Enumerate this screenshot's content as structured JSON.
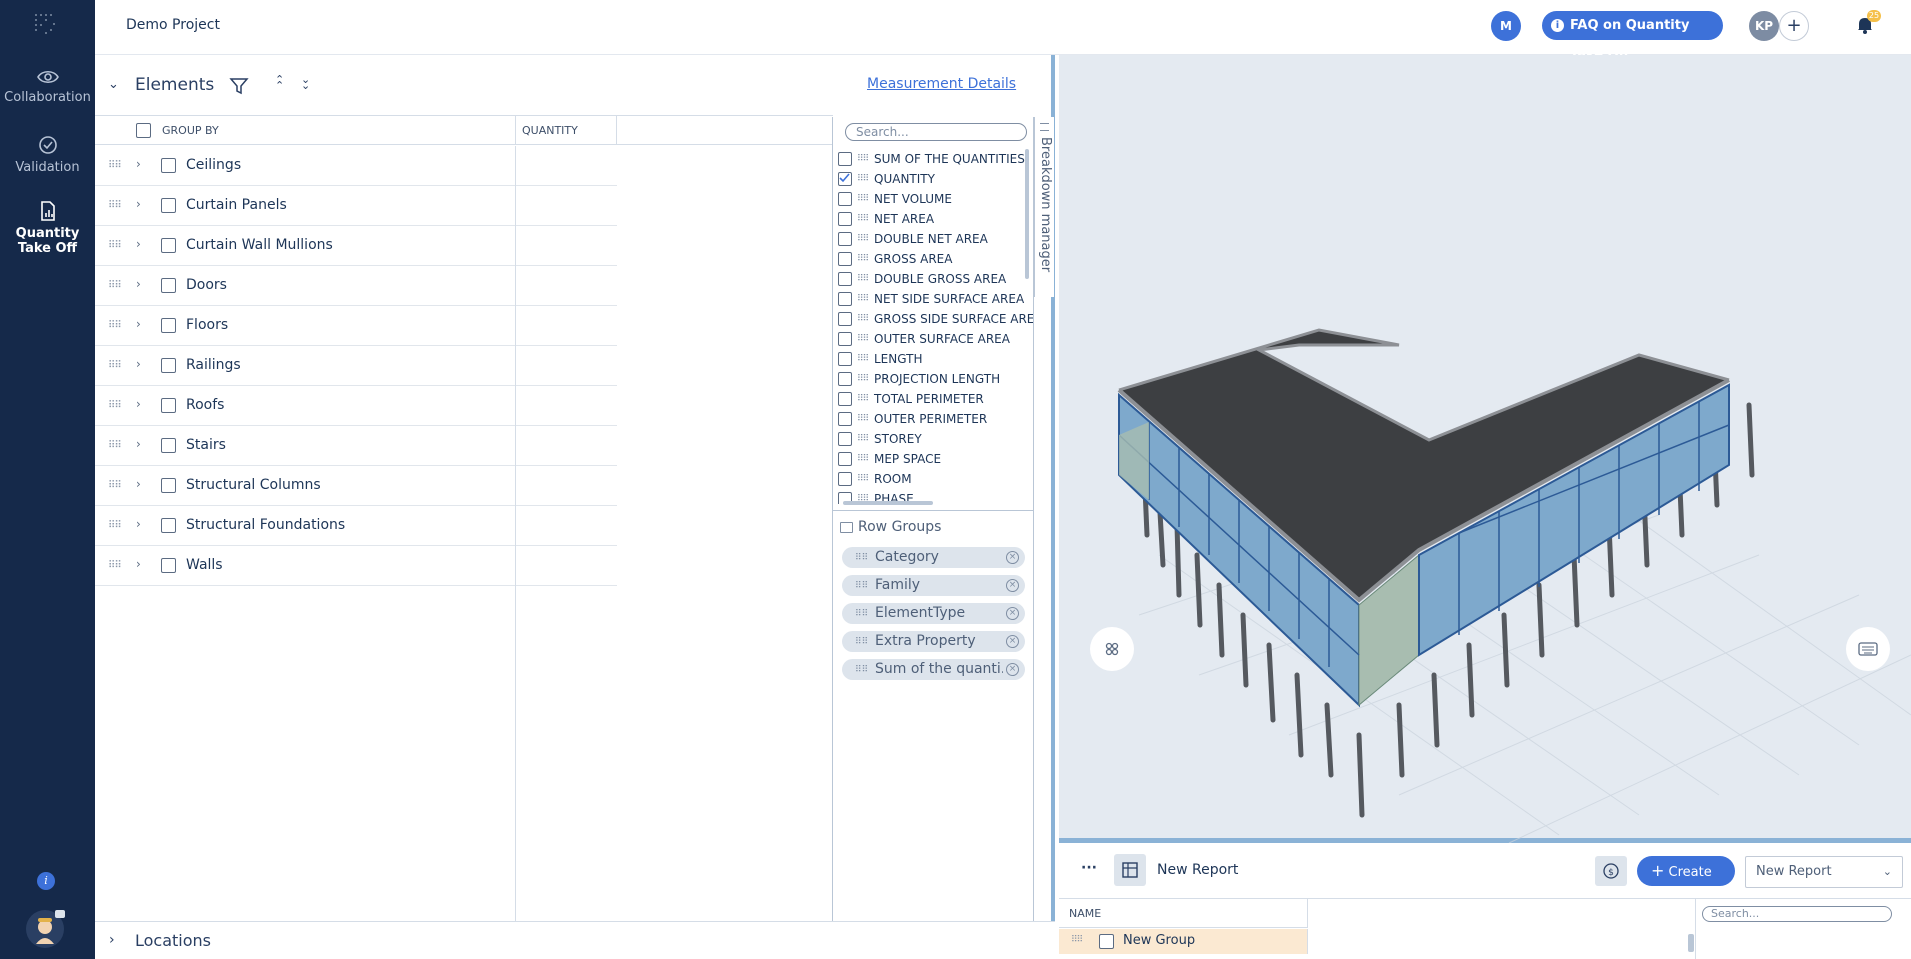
{
  "sidebar": {
    "items": [
      {
        "label": "Collaboration",
        "icon": "eye-icon"
      },
      {
        "label": "Validation",
        "icon": "check-circle-icon"
      },
      {
        "label": "Quantity Take Off",
        "icon": "qto-icon",
        "active": true
      }
    ]
  },
  "topbar": {
    "project": "Demo Project",
    "avatar_m": "M",
    "faq": "FAQ on Quantity Take Off",
    "avatar_kp": "KP",
    "notification_badge": "25"
  },
  "elements": {
    "title": "Elements",
    "measurement_link": "Measurement Details",
    "col_group": "GROUP BY",
    "col_quantity": "QUANTITY",
    "rows": [
      "Ceilings",
      "Curtain Panels",
      "Curtain Wall Mullions",
      "Doors",
      "Floors",
      "Railings",
      "Roofs",
      "Stairs",
      "Structural Columns",
      "Structural Foundations",
      "Walls"
    ]
  },
  "breakdown": {
    "search_placeholder": "Search...",
    "tab_label": "Breakdown manager",
    "columns": [
      {
        "label": "SUM OF THE QUANTITIES",
        "checked": false
      },
      {
        "label": "QUANTITY",
        "checked": true
      },
      {
        "label": "NET VOLUME",
        "checked": false
      },
      {
        "label": "NET AREA",
        "checked": false
      },
      {
        "label": "DOUBLE NET AREA",
        "checked": false
      },
      {
        "label": "GROSS AREA",
        "checked": false
      },
      {
        "label": "DOUBLE GROSS AREA",
        "checked": false
      },
      {
        "label": "NET SIDE SURFACE AREA",
        "checked": false
      },
      {
        "label": "GROSS SIDE SURFACE ARE",
        "checked": false
      },
      {
        "label": "OUTER SURFACE AREA",
        "checked": false
      },
      {
        "label": "LENGTH",
        "checked": false
      },
      {
        "label": "PROJECTION LENGTH",
        "checked": false
      },
      {
        "label": "TOTAL PERIMETER",
        "checked": false
      },
      {
        "label": "OUTER PERIMETER",
        "checked": false
      },
      {
        "label": "STOREY",
        "checked": false
      },
      {
        "label": "MEP SPACE",
        "checked": false
      },
      {
        "label": "ROOM",
        "checked": false
      },
      {
        "label": "PHASE",
        "checked": false
      }
    ],
    "row_groups_title": "Row Groups",
    "row_groups": [
      "Category",
      "Family",
      "ElementType",
      "Extra Property",
      "Sum of the quanti..."
    ]
  },
  "locations": {
    "title": "Locations"
  },
  "report": {
    "more": "···",
    "title": "New Report",
    "create": "Create",
    "select": "New Report",
    "col_name": "NAME",
    "group_name": "New Group",
    "search_placeholder": "Search..."
  }
}
